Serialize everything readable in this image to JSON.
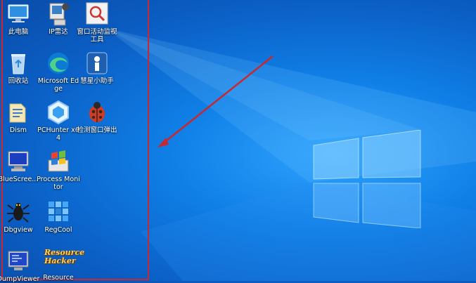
{
  "desktop": {
    "icons": [
      {
        "label": "此电脑",
        "icon": "computer-icon"
      },
      {
        "label": "IP雷达",
        "icon": "ip-radar-icon"
      },
      {
        "label": "窗口活动监视工具",
        "icon": "window-monitor-icon"
      },
      {
        "label": "回收站",
        "icon": "recycle-bin-icon"
      },
      {
        "label": "Microsoft Edge",
        "icon": "edge-icon"
      },
      {
        "label": "慧星小助手",
        "icon": "assistant-icon"
      },
      {
        "label": "Dism",
        "icon": "dism-icon"
      },
      {
        "label": "PCHunter x64",
        "icon": "pchunter-icon"
      },
      {
        "label": "检测窗口弹出",
        "icon": "ladybug-icon"
      },
      {
        "label": "BlueScree...",
        "icon": "bluescreen-icon"
      },
      {
        "label": "Process Monitor",
        "icon": "process-monitor-icon"
      },
      {
        "label": "Dbgview",
        "icon": "dbgview-icon"
      },
      {
        "label": "RegCool",
        "icon": "regcool-icon"
      },
      {
        "label": "DumpViewer",
        "icon": "dumpviewer-icon"
      },
      {
        "label": "Resource",
        "icon": "resource-hacker-icon"
      }
    ],
    "resource_hacker_logo_text": "Resource Hacker"
  },
  "colors": {
    "highlight": "#c8282f",
    "arrow": "#c8282f"
  }
}
